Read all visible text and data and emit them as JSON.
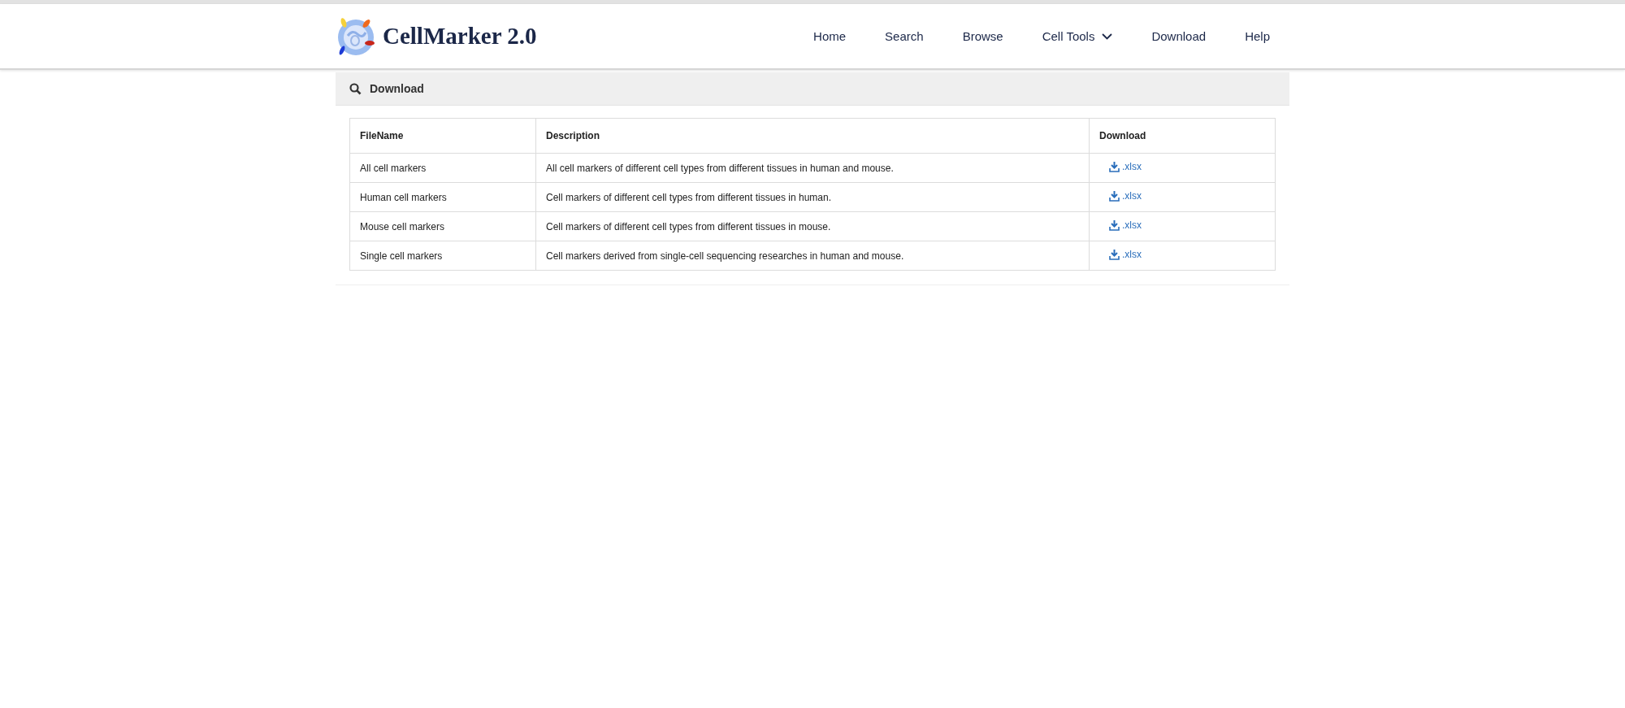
{
  "header": {
    "logo_text": "CellMarker 2.0",
    "nav": [
      {
        "label": "Home",
        "dropdown": false
      },
      {
        "label": "Search",
        "dropdown": false
      },
      {
        "label": "Browse",
        "dropdown": false
      },
      {
        "label": "Cell Tools",
        "dropdown": true
      },
      {
        "label": "Download",
        "dropdown": false
      },
      {
        "label": "Help",
        "dropdown": false
      }
    ]
  },
  "panel": {
    "title": "Download",
    "table": {
      "columns": [
        "FileName",
        "Description",
        "Download"
      ],
      "rows": [
        {
          "file_name": "All cell markers",
          "description": "All cell markers of different cell types from different tissues in human and mouse.",
          "link": ".xlsx"
        },
        {
          "file_name": "Human cell markers",
          "description": "Cell markers of different cell types from different tissues in human.",
          "link": ".xlsx"
        },
        {
          "file_name": "Mouse cell markers",
          "description": "Cell markers of different cell types from different tissues in mouse.",
          "link": ".xlsx"
        },
        {
          "file_name": "Single cell markers",
          "description": "Cell markers derived from single-cell sequencing researches in human and mouse.",
          "link": ".xlsx"
        }
      ]
    }
  }
}
